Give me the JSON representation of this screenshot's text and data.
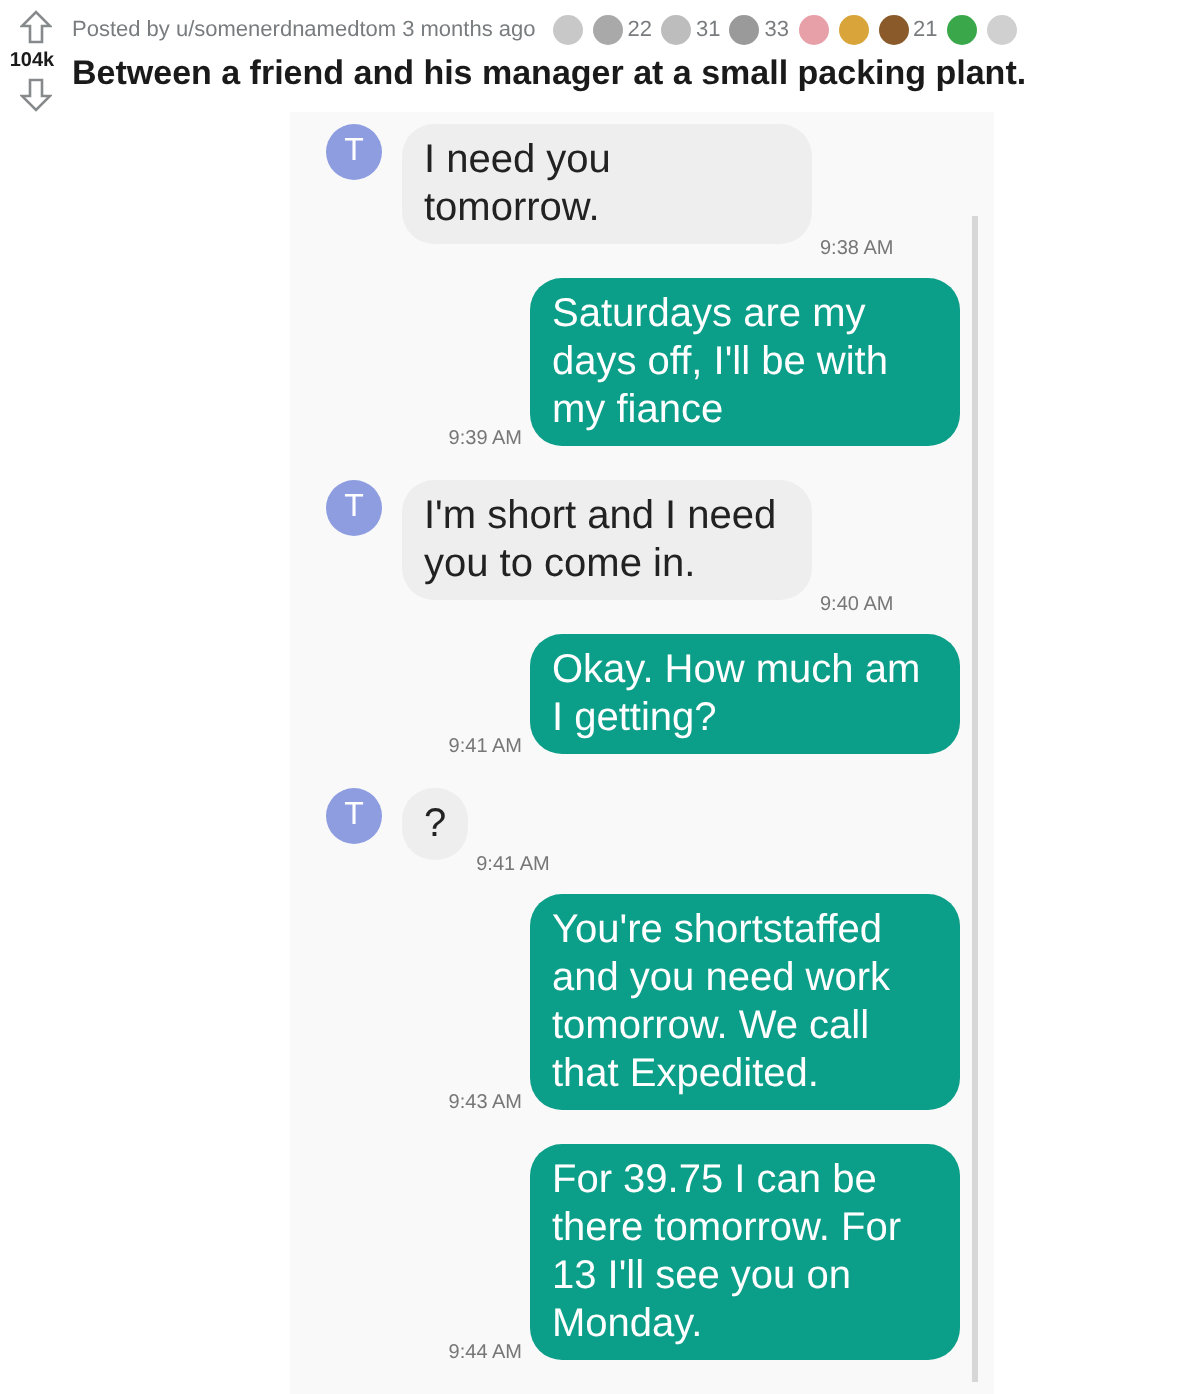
{
  "post": {
    "byline": "Posted by u/somenerdnamedtom 3 months ago",
    "awards": [
      {
        "color": "#c8c8c8"
      },
      {
        "color": "#a9a9a9",
        "count": "22"
      },
      {
        "color": "#bdbdbd",
        "count": "31"
      },
      {
        "color": "#9a9a9a",
        "count": "33"
      },
      {
        "color": "#e8a0a8"
      },
      {
        "color": "#d9a53a"
      },
      {
        "color": "#8a5a2b",
        "count": "21"
      },
      {
        "color": "#3aa84a"
      },
      {
        "color": "#d0d0d0"
      }
    ],
    "votes": "104k",
    "title": "Between a friend and his manager at a small packing plant."
  },
  "chat": {
    "messages": [
      {
        "kind": "incoming",
        "avatar": "T",
        "text": "I need you tomorrow.",
        "time": "9:38 AM"
      },
      {
        "kind": "outgoing",
        "text": "Saturdays are my days off, I'll be with my fiance",
        "time": "9:39 AM"
      },
      {
        "kind": "incoming",
        "avatar": "T",
        "text": "I'm short and I need you to come in.",
        "time": "9:40 AM"
      },
      {
        "kind": "outgoing",
        "text": "Okay. How much am I getting?",
        "time": "9:41 AM"
      },
      {
        "kind": "incoming",
        "avatar": "T",
        "text": "?",
        "time": "9:41 AM"
      },
      {
        "kind": "outgoing",
        "text": "You're shortstaffed and you need work tomorrow. We call that Expedited.",
        "time": "9:43 AM"
      },
      {
        "kind": "outgoing",
        "text": "For 39.75 I can be there tomorrow. For 13 I'll see you on Monday.",
        "time": "9:44 AM"
      }
    ]
  }
}
